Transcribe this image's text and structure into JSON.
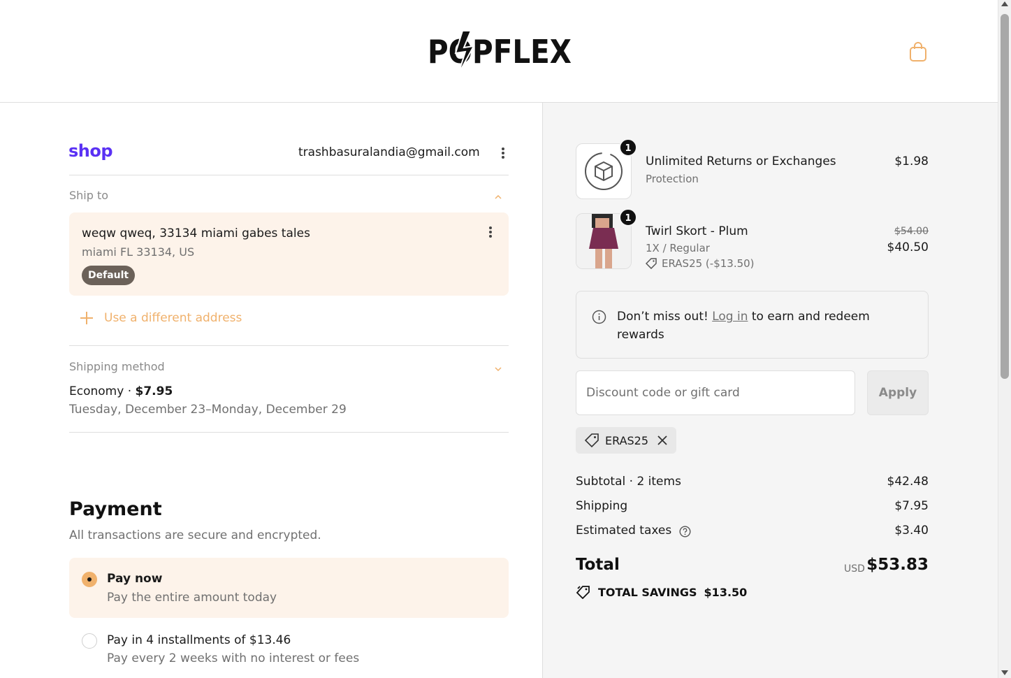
{
  "header": {
    "logo_text": "POPFLEX",
    "cart_icon": "shopping-bag-icon"
  },
  "account": {
    "shop_logo": "shop",
    "email": "trashbasuralandia@gmail.com"
  },
  "ship_to": {
    "label": "Ship to",
    "address_line1": "weqw qweq, 33134 miami gabes tales",
    "address_line2": "miami FL 33134, US",
    "badge": "Default",
    "use_different": "Use a different address"
  },
  "shipping_method": {
    "label": "Shipping method",
    "name": "Economy · ",
    "price": "$7.95",
    "dates": "Tuesday, December 23–Monday, December 29"
  },
  "payment": {
    "title": "Payment",
    "subtitle": "All transactions are secure and encrypted.",
    "options": [
      {
        "title": "Pay now",
        "desc": "Pay the entire amount today",
        "selected": true
      },
      {
        "title": "Pay in 4 installments of $13.46",
        "desc": "Pay every 2 weeks with no interest or fees",
        "selected": false
      }
    ]
  },
  "cart": {
    "items": [
      {
        "name": "Unlimited Returns or Exchanges",
        "sub": "Protection",
        "price": "$1.98",
        "qty": "1"
      },
      {
        "name": "Twirl Skort - Plum",
        "variant": "1X / Regular",
        "discount": "ERAS25 (-$13.50)",
        "original_price": "$54.00",
        "price": "$40.50",
        "qty": "1"
      }
    ],
    "rewards": {
      "prefix": "Don’t miss out! ",
      "link": "Log in",
      "suffix": " to earn and redeem rewards"
    },
    "discount_placeholder": "Discount code or gift card",
    "apply_label": "Apply",
    "applied_code": "ERAS25",
    "summary": {
      "subtotal_label": "Subtotal · 2 items",
      "subtotal": "$42.48",
      "shipping_label": "Shipping",
      "shipping": "$7.95",
      "taxes_label": "Estimated taxes",
      "taxes": "$3.40",
      "total_label": "Total",
      "currency": "USD",
      "total": "$53.83",
      "savings_label": "TOTAL SAVINGS",
      "savings": "$13.50"
    }
  },
  "colors": {
    "accent": "#f0b16c",
    "shop_purple": "#5a31f4",
    "selected_bg": "#fdf3ea",
    "summary_bg": "#f5f5f5"
  }
}
